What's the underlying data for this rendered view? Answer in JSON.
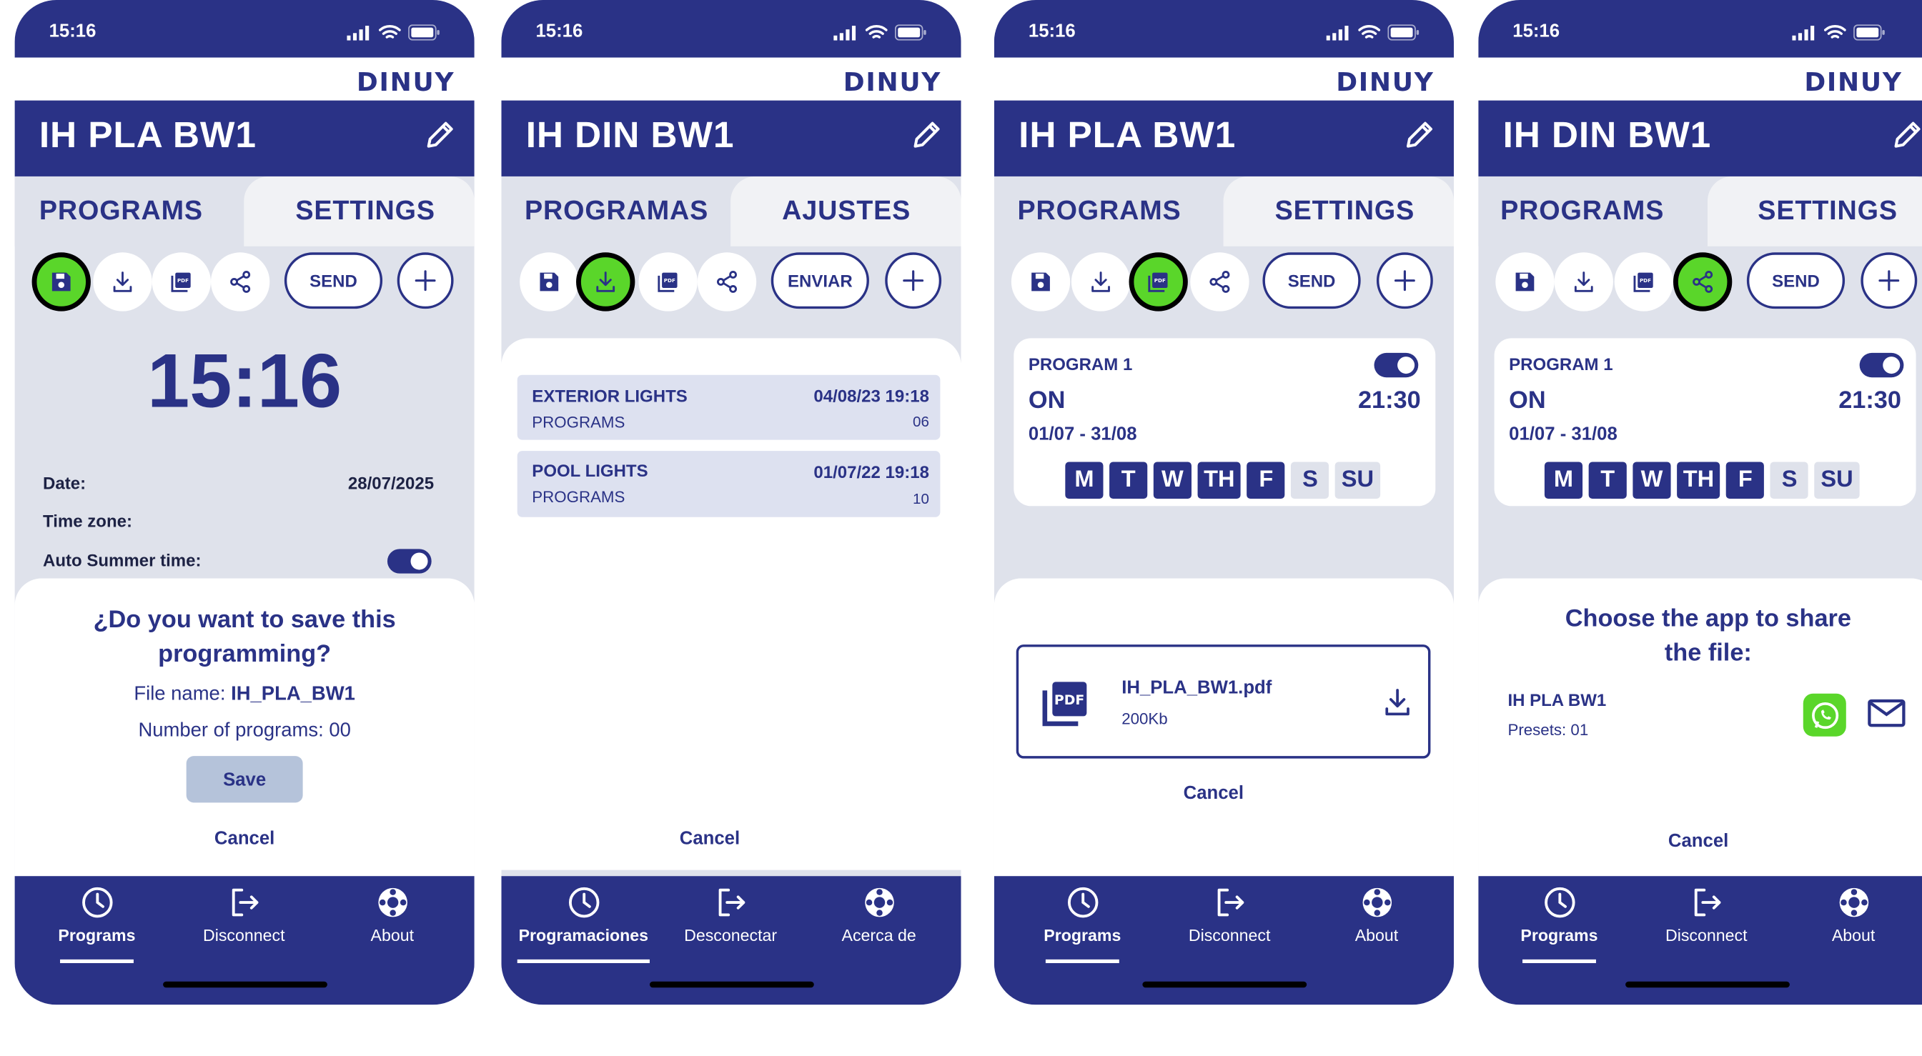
{
  "colors": {
    "primary": "#2a3286",
    "accent_green": "#5ad62a",
    "background_gray": "#dfe2eb",
    "list_item": "#dde1f0"
  },
  "status_time": "15:16",
  "brand": "DINUY",
  "screens": [
    {
      "device_name": "IH PLA BW1",
      "tabs": {
        "programs": "PROGRAMS",
        "settings": "SETTINGS"
      },
      "send_label": "SEND",
      "active_action": "save",
      "clock": "15:16",
      "info": {
        "date_label": "Date:",
        "date_value": "28/07/2025",
        "timezone_label": "Time zone:",
        "summer_label": "Auto Summer time:",
        "summer_enabled": true
      },
      "dialog": {
        "title": "¿Do you want to save this programming?",
        "filename_label": "File name:",
        "filename_value": "IH_PLA_BW1",
        "programs_line": "Number of programs: 00",
        "save_label": "Save",
        "cancel_label": "Cancel"
      },
      "nav": {
        "programs": "Programs",
        "disconnect": "Disconnect",
        "about": "About"
      }
    },
    {
      "device_name": "IH DIN BW1",
      "tabs": {
        "programs": "PROGRAMAS",
        "settings": "AJUSTES"
      },
      "send_label": "ENVIAR",
      "active_action": "download",
      "files": [
        {
          "name": "EXTERIOR LIGHTS",
          "date": "04/08/23 19:18",
          "type": "PROGRAMS",
          "count": "06"
        },
        {
          "name": "POOL LIGHTS",
          "date": "01/07/22 19:18",
          "type": "PROGRAMS",
          "count": "10"
        }
      ],
      "cancel_label": "Cancel",
      "nav": {
        "programs": "Programaciones",
        "disconnect": "Desconectar",
        "about": "Acerca de"
      }
    },
    {
      "device_name": "IH PLA BW1",
      "tabs": {
        "programs": "PROGRAMS",
        "settings": "SETTINGS"
      },
      "send_label": "SEND",
      "active_action": "pdf",
      "program": {
        "title": "PROGRAM 1",
        "state": "ON",
        "time": "21:30",
        "range": "01/07 - 31/08",
        "enabled": true,
        "days": [
          {
            "label": "M",
            "on": true
          },
          {
            "label": "T",
            "on": true
          },
          {
            "label": "W",
            "on": true
          },
          {
            "label": "TH",
            "on": true
          },
          {
            "label": "F",
            "on": true
          },
          {
            "label": "S",
            "on": false
          },
          {
            "label": "SU",
            "on": false
          }
        ]
      },
      "pdf": {
        "badge": "PDF",
        "filename": "IH_PLA_BW1.pdf",
        "size": "200Kb"
      },
      "cancel_label": "Cancel",
      "nav": {
        "programs": "Programs",
        "disconnect": "Disconnect",
        "about": "About"
      }
    },
    {
      "device_name": "IH DIN BW1",
      "tabs": {
        "programs": "PROGRAMS",
        "settings": "SETTINGS"
      },
      "send_label": "SEND",
      "active_action": "share",
      "program": {
        "title": "PROGRAM 1",
        "state": "ON",
        "time": "21:30",
        "range": "01/07 - 31/08",
        "enabled": true,
        "days": [
          {
            "label": "M",
            "on": true
          },
          {
            "label": "T",
            "on": true
          },
          {
            "label": "W",
            "on": true
          },
          {
            "label": "TH",
            "on": true
          },
          {
            "label": "F",
            "on": true
          },
          {
            "label": "S",
            "on": false
          },
          {
            "label": "SU",
            "on": false
          }
        ]
      },
      "share": {
        "title": "Choose the app to share the file:",
        "file_title": "IH PLA BW1",
        "presets": "Presets: 01",
        "apps": [
          "whatsapp-icon",
          "mail-icon"
        ]
      },
      "cancel_label": "Cancel",
      "nav": {
        "programs": "Programs",
        "disconnect": "Disconnect",
        "about": "About"
      }
    }
  ]
}
